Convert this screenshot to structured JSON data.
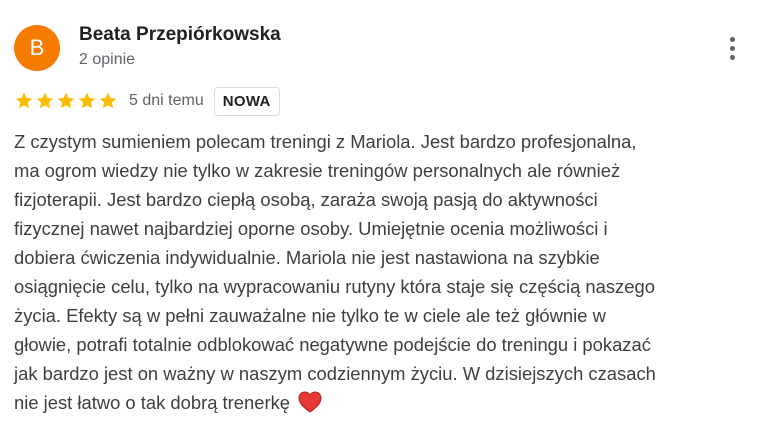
{
  "review": {
    "author": {
      "initial": "B",
      "avatar_color": "#f57c00",
      "name": "Beata Przepiórkowska",
      "meta": "2 opinie"
    },
    "rating": {
      "stars": 5,
      "max_stars": 5,
      "star_color": "#fbbc04"
    },
    "date": "5 dni temu",
    "badge": "NOWA",
    "text_lines": [
      "Z czystym sumieniem polecam treningi z Mariola. Jest bardzo profesjonalna,",
      "ma ogrom wiedzy nie tylko w zakresie treningów personalnych ale również",
      "fizjoterapii. Jest bardzo ciepłą osobą, zaraża swoją pasją do aktywności",
      "fizycznej nawet najbardziej oporne osoby. Umiejętnie ocenia możliwości i",
      "dobiera ćwiczenia indywidualnie. Mariola nie jest nastawiona na szybkie",
      "osiągnięcie celu, tylko na wypracowaniu rutyny która staje się częścią naszego",
      "życia. Efekty są w pełni zauważalne nie tylko te w ciele ale też głównie w",
      "głowie, potrafi totalnie odblokować negatywne podejście do treningu i pokazać",
      "jak bardzo jest on ważny w naszym codziennym życiu. W dzisiejszych czasach",
      "nie jest łatwo o tak dobrą trenerkę"
    ],
    "emoji": "heart-icon"
  }
}
